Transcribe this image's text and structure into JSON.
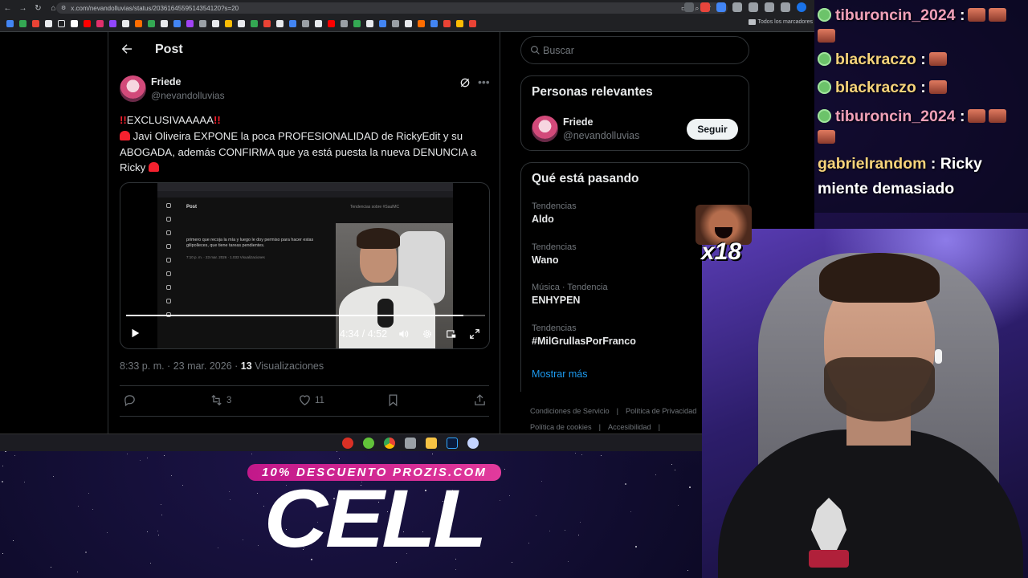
{
  "browser": {
    "url": "x.com/nevandolluvias/status/2036164559514354120?s=20",
    "bookmarks_folder": "Todos los marcadores"
  },
  "post_view": {
    "header_title": "Post",
    "author": {
      "name": "Friede",
      "handle": "@nevandolluvias"
    },
    "tweet_lines": [
      "‼️EXCLUSIVAAAAA‼️",
      "🚨 Javi Oliveira EXPONE la poca PROFESIONALIDAD de RickyEdit y su ABOGADA, además CONFIRMA que ya está puesta la nueva DENUNCIA a Ricky 🚨"
    ],
    "tweet_parts": {
      "exclusive": "EXCLUSIVAAAAA",
      "body": "Javi Oliveira EXPONE la poca PROFESIONALIDAD de RickyEdit y su ABOGADA, además CONFIRMA que ya está puesta la nueva DENUNCIA a Ricky"
    },
    "video": {
      "time": "4:34 / 4:52",
      "progress": 0.94,
      "inner_post_label": "Post",
      "inner_text": "primero que recoja la mía y luego le doy permiso para hacer estas gilipolleces, que tiene tareas pendientes.",
      "inner_date": "7:10 p. m. · 23 mar. 2026 · 1.033 Visualizaciones",
      "inner_search": "Tendencias sobre #SaulMC"
    },
    "meta": {
      "time": "8:33 p. m. · 23 mar. 2026 · ",
      "views_count": "13",
      "views_label": " Visualizaciones"
    },
    "actions": {
      "reposts": "3",
      "likes": "11"
    }
  },
  "sidebar": {
    "search_placeholder": "Buscar",
    "people": {
      "title": "Personas relevantes",
      "name": "Friede",
      "handle": "@nevandolluvias",
      "follow_label": "Seguir"
    },
    "trends": {
      "title": "Qué está pasando",
      "items": [
        {
          "category": "Tendencias",
          "name": "Aldo"
        },
        {
          "category": "Tendencias",
          "name": "Wano"
        },
        {
          "category": "Música · Tendencia",
          "name": "ENHYPEN"
        },
        {
          "category": "Tendencias",
          "name": "#MilGrullasPorFranco"
        }
      ],
      "show_more": "Mostrar más"
    },
    "footer": [
      "Condiciones de Servicio",
      "|",
      "Política de Privacidad",
      "Política de cookies",
      "|",
      "Accesibilidad",
      "|"
    ]
  },
  "chat": {
    "messages": [
      {
        "user": "tiburoncin_2024",
        "text": ":"
      },
      {
        "user": "blackraczo",
        "text": ":"
      },
      {
        "user": "blackraczo",
        "text": ":"
      },
      {
        "user": "tiburoncin_2024",
        "text": ":"
      },
      {
        "user": "gabrielrandom",
        "text": ": Ricky miente demasiado"
      }
    ]
  },
  "emote_overlay": {
    "label": "x18"
  },
  "promo": {
    "banner": "10% DESCUENTO PROZIS.COM",
    "title": "CELL"
  },
  "colors": {
    "accent_blue": "#1d9bf0",
    "promo_pink": "#e23a9c",
    "chat_user_pink": "#f0a0b8",
    "chat_user_gold": "#f6d37a"
  }
}
